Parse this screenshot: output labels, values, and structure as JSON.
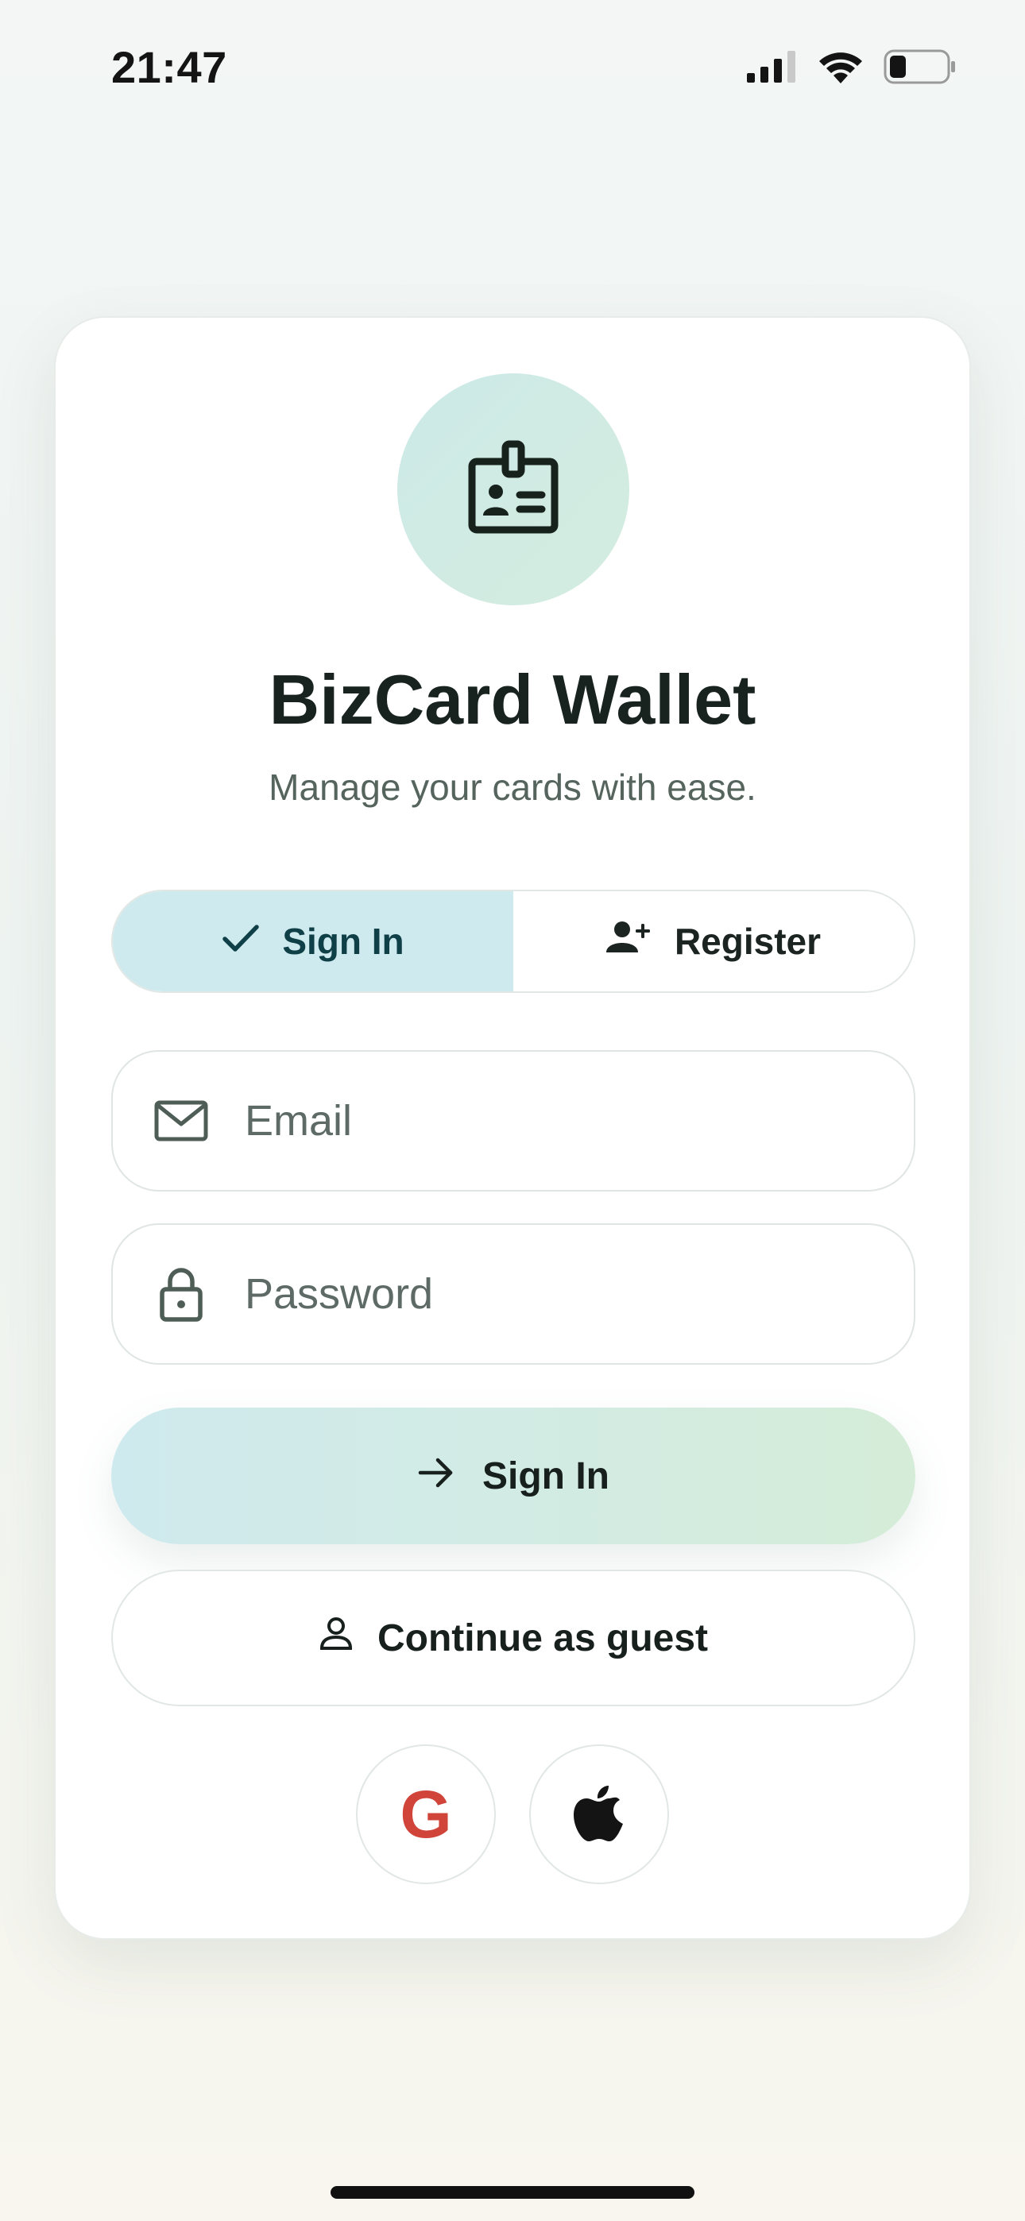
{
  "status_bar": {
    "time": "21:47"
  },
  "app": {
    "title": "BizCard Wallet",
    "subtitle": "Manage your cards with ease."
  },
  "tabs": [
    {
      "label": "Sign In",
      "icon": "check-icon",
      "selected": true
    },
    {
      "label": "Register",
      "icon": "add-person-icon",
      "selected": false
    }
  ],
  "form": {
    "email": {
      "placeholder": "Email",
      "value": "",
      "icon": "mail-icon"
    },
    "password": {
      "placeholder": "Password",
      "value": "",
      "icon": "lock-icon"
    }
  },
  "buttons": {
    "sign_in": {
      "label": "Sign In",
      "icon": "arrow-right-icon"
    },
    "guest": {
      "label": "Continue as guest",
      "icon": "person-icon"
    }
  },
  "social": {
    "google_glyph": "G",
    "google_icon": "google-icon",
    "apple_icon": "apple-icon"
  },
  "colors": {
    "accent_tab": "#cfeaee",
    "accent_green": "#d5ecd8",
    "google_red": "#d0443a"
  }
}
